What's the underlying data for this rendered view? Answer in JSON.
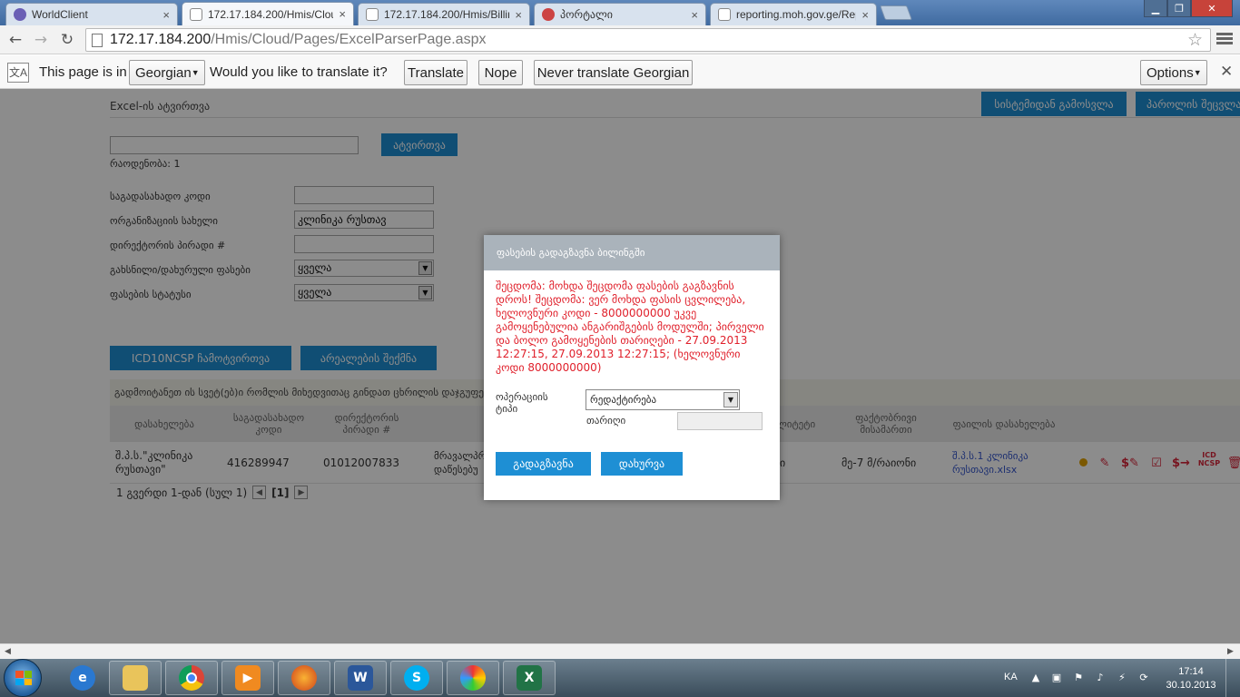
{
  "browser": {
    "tabs": [
      {
        "label": "WorldClient",
        "active": false
      },
      {
        "label": "172.17.184.200/Hmis/Clou",
        "active": true
      },
      {
        "label": "172.17.184.200/Hmis/Billin",
        "active": false
      },
      {
        "label": "პორტალი",
        "active": false
      },
      {
        "label": "reporting.moh.gov.ge/Rep",
        "active": false
      }
    ],
    "url_host": "172.17.184.200",
    "url_path": "/Hmis/Cloud/Pages/ExcelParserPage.aspx"
  },
  "translate_bar": {
    "prefix": "This page is in",
    "language": "Georgian",
    "question": "Would you like to translate it?",
    "translate": "Translate",
    "nope": "Nope",
    "never": "Never translate Georgian",
    "options": "Options"
  },
  "page": {
    "title": "Excel-ის ატვირთვა",
    "logout": "სისტემიდან გამოსვლა",
    "change_password": "პაროლის შეცვლა",
    "upload_button": "ატვირთვა",
    "quantity": "რაოდენობა: 1",
    "filters": [
      {
        "label": "საგადასახადო კოდი",
        "value": "",
        "type": "input"
      },
      {
        "label": "ორგანიზაციის სახელი",
        "value": "კლინიკა რუსთავ",
        "type": "input"
      },
      {
        "label": "დირექტორის პირადი #",
        "value": "",
        "type": "input"
      },
      {
        "label": "გახსნილი/დახურული ფასები",
        "value": "ყველა",
        "type": "select"
      },
      {
        "label": "ფასების სტატუსი",
        "value": "ყველა",
        "type": "select"
      }
    ],
    "icd_button": "ICD10NCSP ჩამოტვირთვა",
    "create_areas_button": "არეალების შექმნა",
    "notice": "გადმოიტანეთ ის სვეტ(ებ)ი რომლის მიხედვითაც გინდათ ცხრილის დაჯგუფება",
    "table": {
      "headers": [
        "დასახელება",
        "საგადასახადო კოდი",
        "დირექტორის პირადი #",
        "",
        "",
        "ვალიტეტი",
        "ფაქტობრივი მისამართი",
        "ფაილის დასახელება",
        ""
      ],
      "row": {
        "name": "შ.პ.ს.\"კლინიკა რუსთავი\"",
        "tax_code": "416289947",
        "director_id": "01012007833",
        "col4": "მრავალპრ დაწესებუ",
        "col6": "ი",
        "address": "მე-7 მ/რაიონი",
        "file": "შ.პ.ს.1 კლინიკა რუსთავი.xlsx",
        "icd_label": "ICD NCSP"
      }
    },
    "pager": {
      "text": "1 გვერდი 1-დან (სულ 1)",
      "current": "[1]"
    }
  },
  "modal": {
    "title": "ფასების გადაგზავნა ბილინგში",
    "message": "შეცდომა: მოხდა შეცდომა ფასების გაგზავნის დროს! შეცდომა: ვერ მოხდა ფასის ცვლილება, ხელოვნური კოდი - 8000000000 უკვე გამოყენებულია ანგარიშგების მოდულში; პირველი და ბოლო გამოყენების თარიღები - 27.09.2013 12:27:15, 27.09.2013 12:27:15; (ხელოვნური კოდი 8000000000)",
    "operation_label": "ოპერაციის ტიპი",
    "operation_value": "რედაქტირება",
    "date_label": "თარიღი",
    "date_value": "",
    "send_button": "გადაგზავნა",
    "close_button": "დახურვა"
  },
  "taskbar": {
    "apps": [
      "windows-explorer",
      "internet-explorer",
      "file-manager",
      "google-chrome",
      "media-player",
      "firefox",
      "microsoft-word",
      "skype",
      "paint",
      "microsoft-excel"
    ],
    "lang": "KA",
    "time": "17:14",
    "date": "30.10.2013"
  },
  "colors": {
    "accent_blue": "#1e8fd4",
    "error_red": "#e0202b",
    "modal_header": "#aab3bb"
  }
}
